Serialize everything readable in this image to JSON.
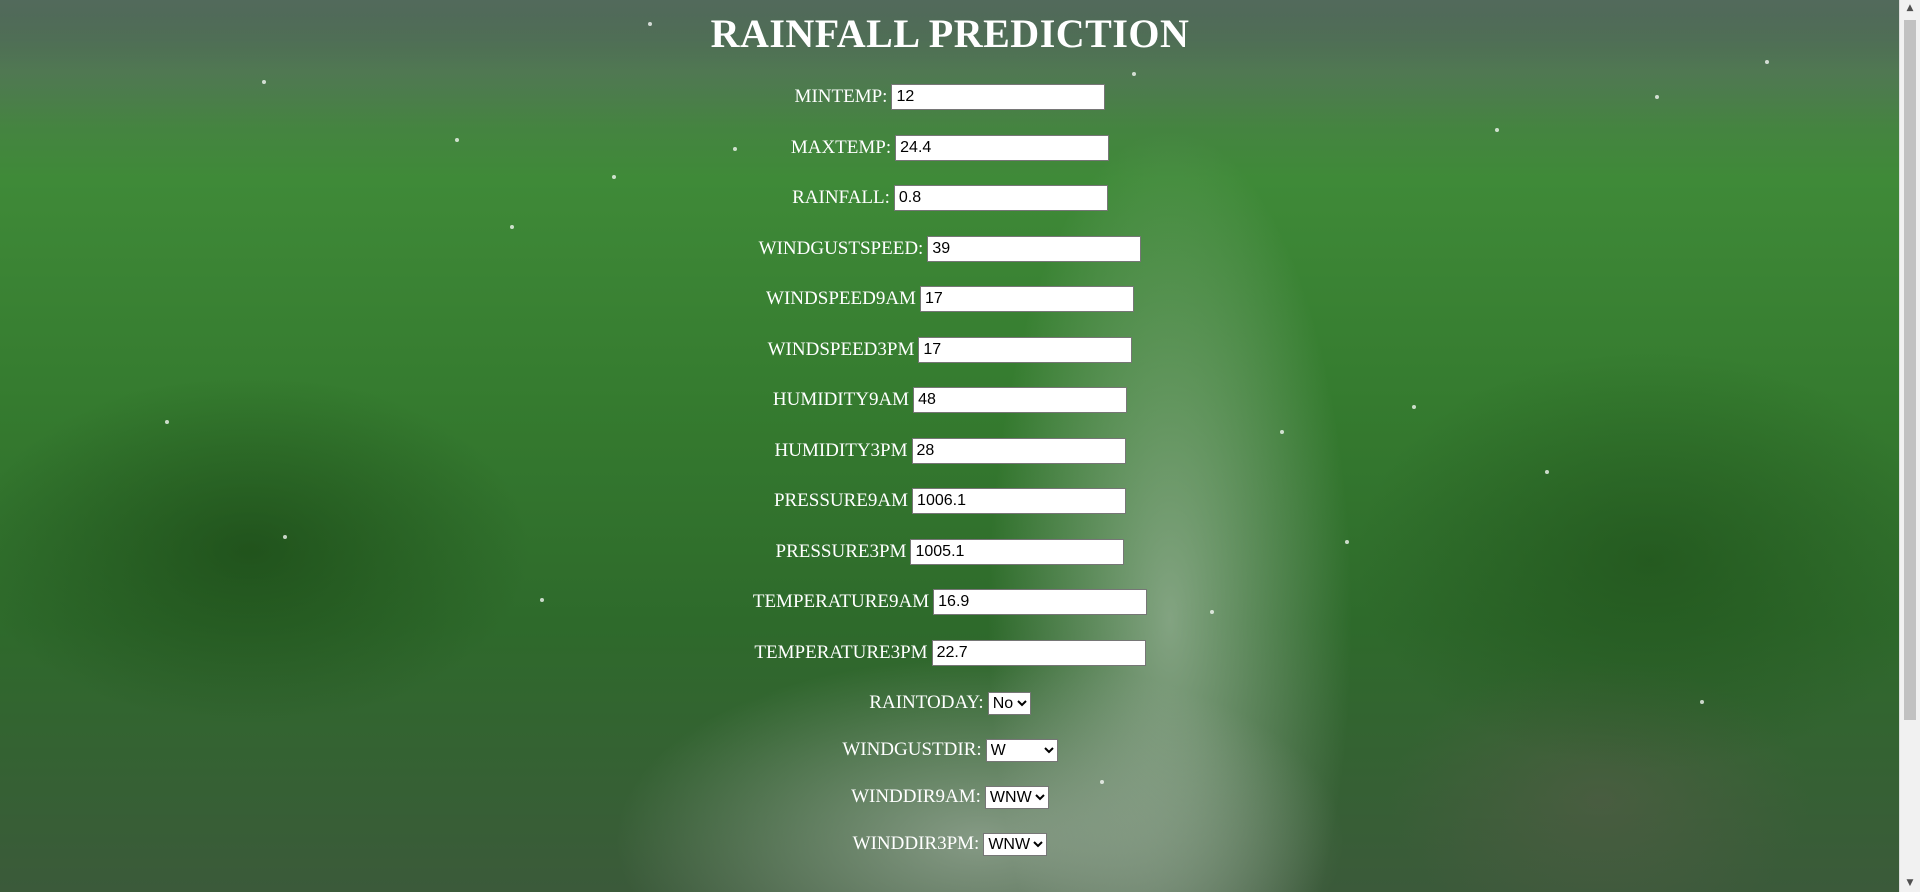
{
  "title": "RAINFALL PREDICTION",
  "fields": [
    {
      "label": "MINTEMP:",
      "value": "12"
    },
    {
      "label": "MAXTEMP:",
      "value": "24.4"
    },
    {
      "label": "RAINFALL:",
      "value": "0.8"
    },
    {
      "label": "WINDGUSTSPEED:",
      "value": "39"
    },
    {
      "label": "WINDSPEED9AM",
      "value": "17"
    },
    {
      "label": "WINDSPEED3PM",
      "value": "17"
    },
    {
      "label": "HUMIDITY9AM",
      "value": "48"
    },
    {
      "label": "HUMIDITY3PM",
      "value": "28"
    },
    {
      "label": "PRESSURE9AM",
      "value": "1006.1"
    },
    {
      "label": "PRESSURE3PM",
      "value": "1005.1"
    },
    {
      "label": "TEMPERATURE9AM",
      "value": "16.9"
    },
    {
      "label": "TEMPERATURE3PM",
      "value": "22.7"
    }
  ],
  "selects": [
    {
      "label": "RAINTODAY:",
      "value": "No"
    },
    {
      "label": "WINDGUSTDIR:",
      "value": "W"
    },
    {
      "label": "WINDDIR9AM:",
      "value": "WNW"
    },
    {
      "label": "WINDDIR3PM:",
      "value": "WNW"
    }
  ],
  "colors": {
    "text": "#ffffff",
    "background_grass": "#357b2f"
  },
  "scrollbar": {
    "up_icon": "triangle-up",
    "down_icon": "triangle-down"
  }
}
